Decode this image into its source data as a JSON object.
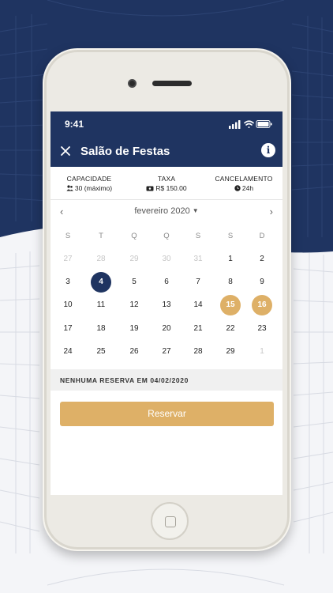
{
  "status_bar": {
    "time": "9:41"
  },
  "header": {
    "title": "Salão de Festas",
    "close_icon": "close-icon",
    "info_icon": "info-icon",
    "info_glyph": "i"
  },
  "stats": [
    {
      "label": "CAPACIDADE",
      "value": "30 (máximo)",
      "icon": "people-icon"
    },
    {
      "label": "TAXA",
      "value": "R$ 150.00",
      "icon": "money-icon"
    },
    {
      "label": "CANCELAMENTO",
      "value": "24h",
      "icon": "clock-icon"
    }
  ],
  "calendar": {
    "month_label": "fevereiro 2020",
    "weekdays": [
      "S",
      "T",
      "Q",
      "Q",
      "S",
      "S",
      "D"
    ],
    "weeks": [
      [
        {
          "d": "27",
          "m": true
        },
        {
          "d": "28",
          "m": true
        },
        {
          "d": "29",
          "m": true
        },
        {
          "d": "30",
          "m": true
        },
        {
          "d": "31",
          "m": true
        },
        {
          "d": "1"
        },
        {
          "d": "2"
        }
      ],
      [
        {
          "d": "3"
        },
        {
          "d": "4",
          "s": true
        },
        {
          "d": "5"
        },
        {
          "d": "6"
        },
        {
          "d": "7"
        },
        {
          "d": "8"
        },
        {
          "d": "9"
        }
      ],
      [
        {
          "d": "10"
        },
        {
          "d": "11"
        },
        {
          "d": "12"
        },
        {
          "d": "13"
        },
        {
          "d": "14"
        },
        {
          "d": "15",
          "b": true
        },
        {
          "d": "16",
          "b": true
        }
      ],
      [
        {
          "d": "17"
        },
        {
          "d": "18"
        },
        {
          "d": "19"
        },
        {
          "d": "20"
        },
        {
          "d": "21"
        },
        {
          "d": "22"
        },
        {
          "d": "23"
        }
      ],
      [
        {
          "d": "24"
        },
        {
          "d": "25"
        },
        {
          "d": "26"
        },
        {
          "d": "27"
        },
        {
          "d": "28"
        },
        {
          "d": "29"
        },
        {
          "d": "1",
          "m": true
        }
      ]
    ]
  },
  "notice": "NENHUMA RESERVA EM 04/02/2020",
  "reserve_button": "Reservar",
  "colors": {
    "navy": "#1f3461",
    "gold": "#deb067"
  }
}
